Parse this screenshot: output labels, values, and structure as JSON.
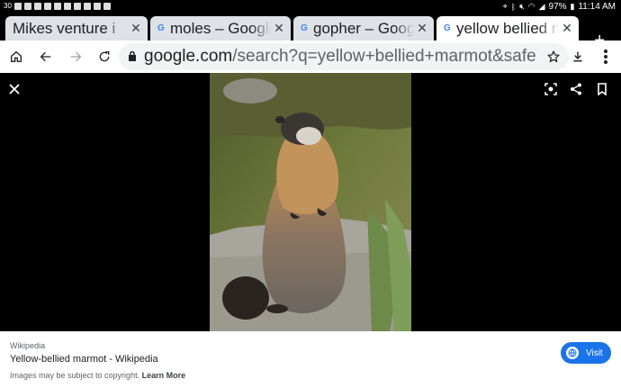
{
  "status_bar": {
    "left_number": "30",
    "battery": "97%",
    "time": "11:14 AM"
  },
  "tabs": [
    {
      "label": "Mikes venture i",
      "favicon": "",
      "active": false
    },
    {
      "label": "moles – Google",
      "favicon": "G",
      "active": false
    },
    {
      "label": "gopher – Googl",
      "favicon": "G",
      "active": false
    },
    {
      "label": "yellow bellied m",
      "favicon": "G",
      "active": true
    }
  ],
  "toolbar": {
    "url_domain": "google.com",
    "url_path": "/search?q=yellow+bellied+marmot&safe"
  },
  "icons": {
    "home": "home-icon",
    "back": "back-arrow-icon",
    "forward": "forward-arrow-icon",
    "reload": "reload-icon",
    "bookmark": "star-icon",
    "download": "download-icon",
    "menu": "more-vert-icon",
    "close": "close-icon",
    "lens": "lens-icon",
    "share": "share-icon",
    "save": "bookmark-icon",
    "visit": "globe-icon"
  },
  "result": {
    "source": "Wikipedia",
    "title": "Yellow-bellied marmot - Wikipedia",
    "copyright_text": "Images may be subject to copyright. ",
    "learn_more": "Learn More",
    "visit_label": "Visit"
  },
  "colors": {
    "accent": "#1a73e8",
    "tab_inactive": "#dee1e6",
    "omnibox_bg": "#f1f3f4"
  }
}
